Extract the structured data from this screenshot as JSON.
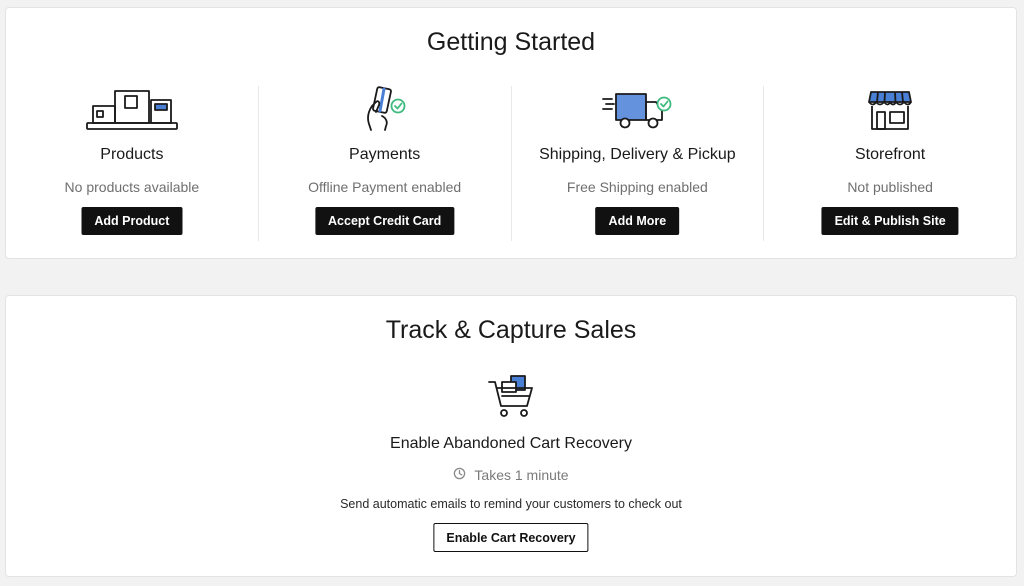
{
  "getting_started": {
    "title": "Getting Started",
    "steps": [
      {
        "icon": "boxes-icon",
        "title": "Products",
        "status": "No products available",
        "button": "Add Product"
      },
      {
        "icon": "credit-card-hand-icon",
        "title": "Payments",
        "status": "Offline Payment enabled",
        "button": "Accept Credit Card"
      },
      {
        "icon": "delivery-truck-icon",
        "title": "Shipping, Delivery & Pickup",
        "status": "Free Shipping enabled",
        "button": "Add More"
      },
      {
        "icon": "storefront-icon",
        "title": "Storefront",
        "status": "Not published",
        "button": "Edit & Publish Site"
      }
    ]
  },
  "track": {
    "title": "Track & Capture Sales",
    "icon": "shopping-cart-icon",
    "item_title": "Enable Abandoned Cart Recovery",
    "time_icon": "clock-icon",
    "time": "Takes 1 minute",
    "description": "Send automatic emails to remind your customers to check out",
    "button": "Enable Cart Recovery"
  },
  "colors": {
    "accent_blue": "#4a7fd6",
    "check_green": "#3dba7e",
    "button_dark": "#111111"
  }
}
